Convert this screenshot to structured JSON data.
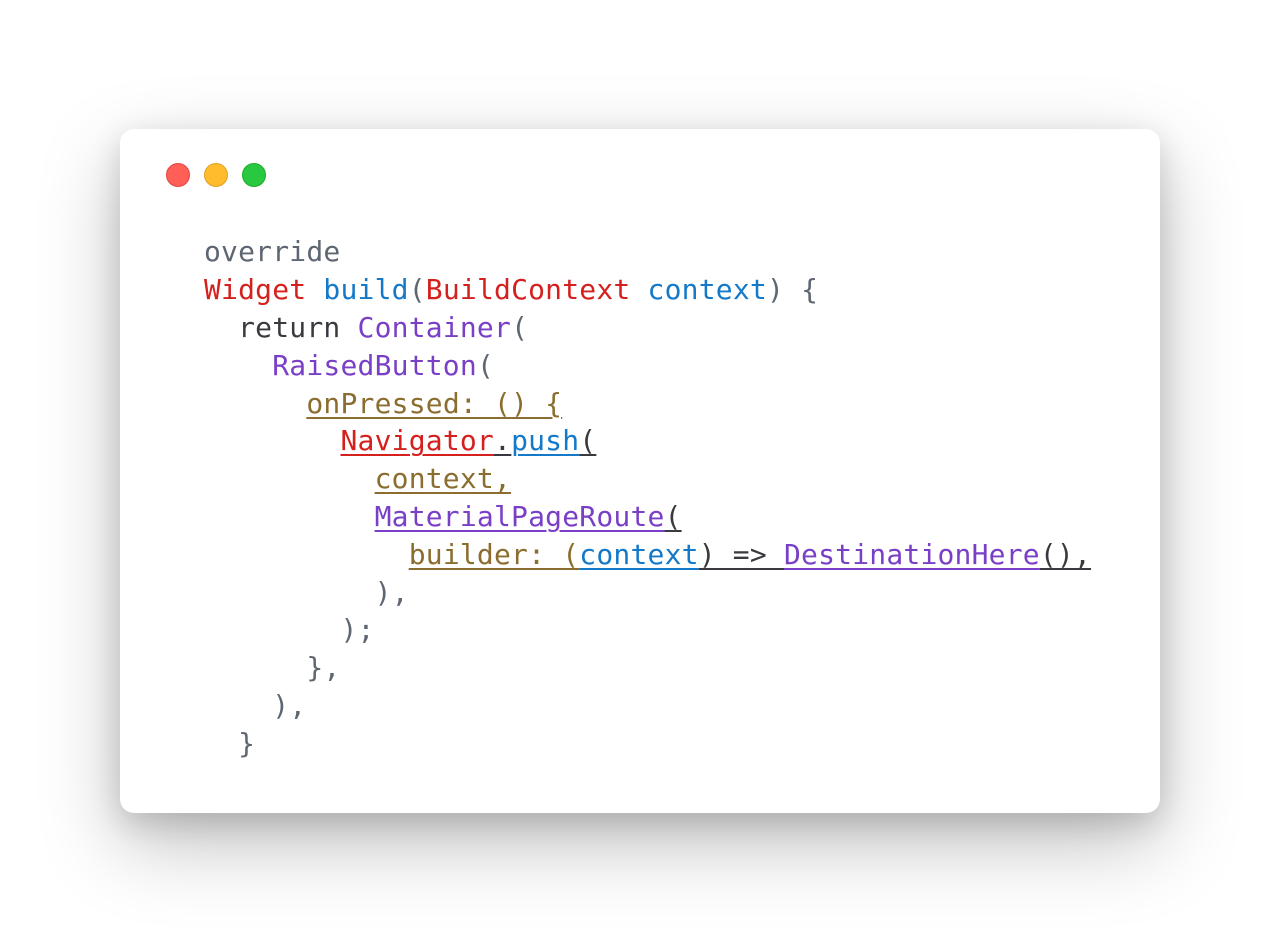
{
  "traffic_lights": {
    "close": "close",
    "min": "minimize",
    "max": "maximize"
  },
  "code": {
    "l1_override": "override",
    "l2_widget": "Widget",
    "l2_sp1": " ",
    "l2_build": "build",
    "l2_p1": "(",
    "l2_bc": "BuildContext",
    "l2_sp2": " ",
    "l2_ctx": "context",
    "l2_tail": ") {",
    "l3_return": "  return ",
    "l3_container": "Container",
    "l3_p": "(",
    "l4_indent": "    ",
    "l4_rb": "RaisedButton",
    "l4_p": "(",
    "l5_indent": "      ",
    "l5_onpressed": "onPressed: () {",
    "l6_indent": "        ",
    "l6_nav": "Navigator",
    "l6_dot": ".",
    "l6_push": "push",
    "l6_p": "(",
    "l7_indent": "          ",
    "l7_ctx": "context,",
    "l8_indent": "          ",
    "l8_mpr": "MaterialPageRoute",
    "l8_p": "(",
    "l9_indent": "            ",
    "l9_builder": "builder: (",
    "l9_ctx": "context",
    "l9_arrow": ") => ",
    "l9_dest": "DestinationHere",
    "l9_tail": "(),",
    "l10": "          ),",
    "l11": "        );",
    "l12": "      },",
    "l13": "    ),",
    "l14": "  }"
  }
}
